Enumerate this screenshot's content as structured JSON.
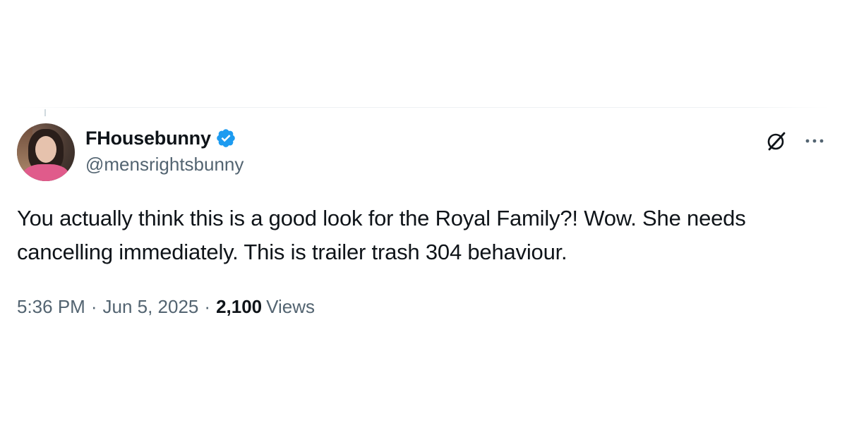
{
  "tweet": {
    "display_name": "FHousebunny",
    "handle": "@mensrightsbunny",
    "verified": true,
    "text": "You actually think this is a good look for the Royal Family?! Wow. She needs cancelling immediately. This is trailer trash 304 behaviour.",
    "time": "5:36 PM",
    "date": "Jun 5, 2025",
    "separator": "·",
    "views_count": "2,100",
    "views_label": "Views"
  },
  "icons": {
    "verified": "verified-badge-icon",
    "grok": "grok-icon",
    "more": "more-options-icon"
  },
  "colors": {
    "verified_blue": "#1d9bf0",
    "text_primary": "#0f1419",
    "text_secondary": "#536471"
  }
}
